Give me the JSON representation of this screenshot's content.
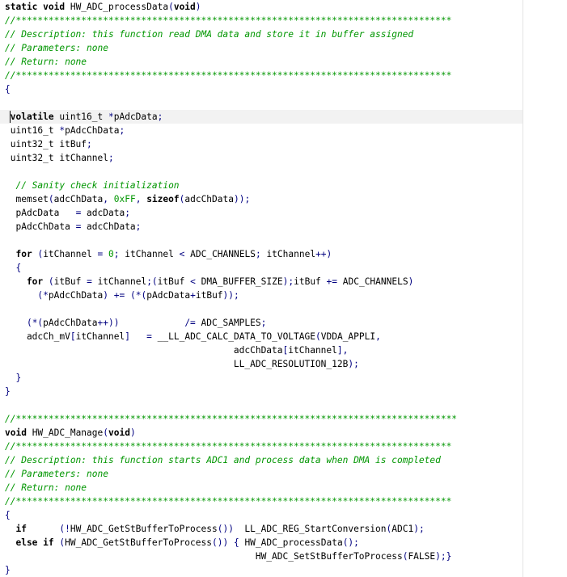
{
  "editor": {
    "lines": [
      [
        {
          "t": "static void",
          "c": "kw"
        },
        {
          "t": " HW_ADC_processData",
          "c": "fn"
        },
        {
          "t": "(",
          "c": "op"
        },
        {
          "t": "void",
          "c": "kw"
        },
        {
          "t": ")",
          "c": "op"
        }
      ],
      [
        {
          "t": "//********************************************************************************",
          "c": "cmt"
        }
      ],
      [
        {
          "t": "// Description: this function read DMA data and store it in buffer assigned",
          "c": "cmt"
        }
      ],
      [
        {
          "t": "// Parameters: none",
          "c": "cmt"
        }
      ],
      [
        {
          "t": "// Return: none",
          "c": "cmt"
        }
      ],
      [
        {
          "t": "//********************************************************************************",
          "c": "cmt"
        }
      ],
      [
        {
          "t": "{",
          "c": "op"
        }
      ],
      [],
      [
        {
          "t": " volatile",
          "c": "kw"
        },
        {
          "t": " uint16_t ",
          "c": ""
        },
        {
          "t": "*",
          "c": "op"
        },
        {
          "t": "pAdcData",
          "c": ""
        },
        {
          "t": ";",
          "c": "op"
        }
      ],
      [
        {
          "t": " uint16_t ",
          "c": ""
        },
        {
          "t": "*",
          "c": "op"
        },
        {
          "t": "pAdcChData",
          "c": ""
        },
        {
          "t": ";",
          "c": "op"
        }
      ],
      [
        {
          "t": " uint32_t itBuf",
          "c": ""
        },
        {
          "t": ";",
          "c": "op"
        }
      ],
      [
        {
          "t": " uint32_t itChannel",
          "c": ""
        },
        {
          "t": ";",
          "c": "op"
        }
      ],
      [],
      [
        {
          "t": "  // Sanity check initialization",
          "c": "cmt"
        }
      ],
      [
        {
          "t": "  memset",
          "c": ""
        },
        {
          "t": "(",
          "c": "op"
        },
        {
          "t": "adcChData",
          "c": ""
        },
        {
          "t": ", ",
          "c": "op"
        },
        {
          "t": "0xFF",
          "c": "num"
        },
        {
          "t": ", ",
          "c": "op"
        },
        {
          "t": "sizeof",
          "c": "kw"
        },
        {
          "t": "(",
          "c": "op"
        },
        {
          "t": "adcChData",
          "c": ""
        },
        {
          "t": "));",
          "c": "op"
        }
      ],
      [
        {
          "t": "  pAdcData   ",
          "c": ""
        },
        {
          "t": "=",
          "c": "op"
        },
        {
          "t": " adcData",
          "c": ""
        },
        {
          "t": ";",
          "c": "op"
        }
      ],
      [
        {
          "t": "  pAdcChData ",
          "c": ""
        },
        {
          "t": "=",
          "c": "op"
        },
        {
          "t": " adcChData",
          "c": ""
        },
        {
          "t": ";",
          "c": "op"
        }
      ],
      [],
      [
        {
          "t": "  for",
          "c": "kw"
        },
        {
          "t": " ",
          "c": ""
        },
        {
          "t": "(",
          "c": "op"
        },
        {
          "t": "itChannel ",
          "c": ""
        },
        {
          "t": "=",
          "c": "op"
        },
        {
          "t": " ",
          "c": ""
        },
        {
          "t": "0",
          "c": "num"
        },
        {
          "t": "; ",
          "c": "op"
        },
        {
          "t": "itChannel ",
          "c": ""
        },
        {
          "t": "<",
          "c": "op"
        },
        {
          "t": " ADC_CHANNELS",
          "c": ""
        },
        {
          "t": "; ",
          "c": "op"
        },
        {
          "t": "itChannel",
          "c": ""
        },
        {
          "t": "++)",
          "c": "op"
        }
      ],
      [
        {
          "t": "  {",
          "c": "op"
        }
      ],
      [
        {
          "t": "    for",
          "c": "kw"
        },
        {
          "t": " ",
          "c": ""
        },
        {
          "t": "(",
          "c": "op"
        },
        {
          "t": "itBuf ",
          "c": ""
        },
        {
          "t": "=",
          "c": "op"
        },
        {
          "t": " itChannel",
          "c": ""
        },
        {
          "t": ";(",
          "c": "op"
        },
        {
          "t": "itBuf ",
          "c": ""
        },
        {
          "t": "<",
          "c": "op"
        },
        {
          "t": " DMA_BUFFER_SIZE",
          "c": ""
        },
        {
          "t": ");",
          "c": "op"
        },
        {
          "t": "itBuf ",
          "c": ""
        },
        {
          "t": "+=",
          "c": "op"
        },
        {
          "t": " ADC_CHANNELS",
          "c": ""
        },
        {
          "t": ")",
          "c": "op"
        }
      ],
      [
        {
          "t": "      ",
          "c": ""
        },
        {
          "t": "(*",
          "c": "op"
        },
        {
          "t": "pAdcChData",
          "c": ""
        },
        {
          "t": ")",
          "c": "op"
        },
        {
          "t": " ",
          "c": ""
        },
        {
          "t": "+=",
          "c": "op"
        },
        {
          "t": " ",
          "c": ""
        },
        {
          "t": "(*(",
          "c": "op"
        },
        {
          "t": "pAdcData",
          "c": ""
        },
        {
          "t": "+",
          "c": "op"
        },
        {
          "t": "itBuf",
          "c": ""
        },
        {
          "t": "));",
          "c": "op"
        }
      ],
      [],
      [
        {
          "t": "    ",
          "c": ""
        },
        {
          "t": "(*(",
          "c": "op"
        },
        {
          "t": "pAdcChData",
          "c": ""
        },
        {
          "t": "++))",
          "c": "op"
        },
        {
          "t": "            ",
          "c": ""
        },
        {
          "t": "/=",
          "c": "op"
        },
        {
          "t": " ADC_SAMPLES",
          "c": ""
        },
        {
          "t": ";",
          "c": "op"
        }
      ],
      [
        {
          "t": "    adcCh_mV",
          "c": ""
        },
        {
          "t": "[",
          "c": "op"
        },
        {
          "t": "itChannel",
          "c": ""
        },
        {
          "t": "]",
          "c": "op"
        },
        {
          "t": "   ",
          "c": ""
        },
        {
          "t": "=",
          "c": "op"
        },
        {
          "t": " __LL_ADC_CALC_DATA_TO_VOLTAGE",
          "c": ""
        },
        {
          "t": "(",
          "c": "op"
        },
        {
          "t": "VDDA_APPLI",
          "c": ""
        },
        {
          "t": ",",
          "c": "op"
        }
      ],
      [
        {
          "t": "                                          adcChData",
          "c": ""
        },
        {
          "t": "[",
          "c": "op"
        },
        {
          "t": "itChannel",
          "c": ""
        },
        {
          "t": "],",
          "c": "op"
        }
      ],
      [
        {
          "t": "                                          LL_ADC_RESOLUTION_12B",
          "c": ""
        },
        {
          "t": ");",
          "c": "op"
        }
      ],
      [
        {
          "t": "  }",
          "c": "op"
        }
      ],
      [
        {
          "t": "}",
          "c": "op"
        }
      ],
      [],
      [
        {
          "t": "//*********************************************************************************",
          "c": "cmt"
        }
      ],
      [
        {
          "t": "void",
          "c": "kw"
        },
        {
          "t": " HW_ADC_Manage",
          "c": ""
        },
        {
          "t": "(",
          "c": "op"
        },
        {
          "t": "void",
          "c": "kw"
        },
        {
          "t": ")",
          "c": "op"
        }
      ],
      [
        {
          "t": "//********************************************************************************",
          "c": "cmt"
        }
      ],
      [
        {
          "t": "// Description: this function starts ADC1 and process data when DMA is completed",
          "c": "cmt"
        }
      ],
      [
        {
          "t": "// Parameters: none",
          "c": "cmt"
        }
      ],
      [
        {
          "t": "// Return: none",
          "c": "cmt"
        }
      ],
      [
        {
          "t": "//********************************************************************************",
          "c": "cmt"
        }
      ],
      [
        {
          "t": "{",
          "c": "op"
        }
      ],
      [
        {
          "t": "  if",
          "c": "kw"
        },
        {
          "t": "      ",
          "c": ""
        },
        {
          "t": "(!",
          "c": "op"
        },
        {
          "t": "HW_ADC_GetStBufferToProcess",
          "c": ""
        },
        {
          "t": "())",
          "c": "op"
        },
        {
          "t": "  LL_ADC_REG_StartConversion",
          "c": ""
        },
        {
          "t": "(",
          "c": "op"
        },
        {
          "t": "ADC1",
          "c": ""
        },
        {
          "t": ");",
          "c": "op"
        }
      ],
      [
        {
          "t": "  else if",
          "c": "kw"
        },
        {
          "t": " ",
          "c": ""
        },
        {
          "t": "(",
          "c": "op"
        },
        {
          "t": "HW_ADC_GetStBufferToProcess",
          "c": ""
        },
        {
          "t": "())",
          "c": "op"
        },
        {
          "t": " ",
          "c": ""
        },
        {
          "t": "{",
          "c": "op"
        },
        {
          "t": " HW_ADC_processData",
          "c": ""
        },
        {
          "t": "();",
          "c": "op"
        }
      ],
      [
        {
          "t": "                                              HW_ADC_SetStBufferToProcess",
          "c": ""
        },
        {
          "t": "(",
          "c": "op"
        },
        {
          "t": "FALSE",
          "c": ""
        },
        {
          "t": ");}",
          "c": "op"
        }
      ],
      [
        {
          "t": "}",
          "c": "op"
        }
      ]
    ],
    "current_line_index": 8
  }
}
